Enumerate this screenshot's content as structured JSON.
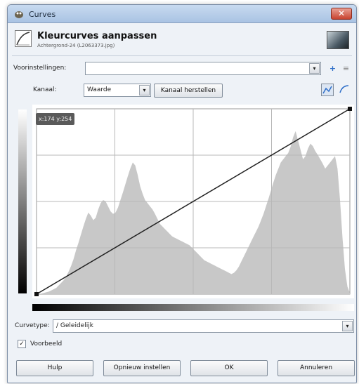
{
  "window": {
    "title": "Curves",
    "close_label": "✕"
  },
  "header": {
    "title": "Kleurcurves aanpassen",
    "subtitle": "Achtergrond-24 (L2063373.jpg)"
  },
  "presets": {
    "label": "Voorinstellingen:",
    "value": "",
    "arrow": "▾",
    "add_icon": "plus-icon",
    "menu_icon": "menu-icon"
  },
  "channel": {
    "label": "Kanaal:",
    "value": "Waarde",
    "arrow": "▾",
    "reset_label": "Kanaal herstellen",
    "linear_icon": "linear-histogram-icon",
    "log_icon": "log-histogram-icon"
  },
  "curve": {
    "coordinates": "x:174 y:254",
    "histogram": [
      0,
      0,
      1,
      2,
      3,
      4,
      6,
      8,
      10,
      14,
      18,
      22,
      28,
      36,
      45,
      56,
      70,
      82,
      95,
      108,
      120,
      130,
      125,
      118,
      122,
      135,
      145,
      150,
      148,
      140,
      132,
      128,
      130,
      138,
      150,
      162,
      175,
      188,
      200,
      210,
      205,
      190,
      172,
      160,
      150,
      145,
      140,
      135,
      128,
      120,
      112,
      108,
      104,
      100,
      96,
      92,
      90,
      88,
      86,
      84,
      82,
      80,
      78,
      74,
      70,
      66,
      62,
      58,
      54,
      52,
      50,
      48,
      46,
      44,
      42,
      40,
      38,
      36,
      34,
      32,
      34,
      38,
      44,
      52,
      60,
      68,
      76,
      84,
      92,
      100,
      108,
      118,
      128,
      140,
      152,
      165,
      178,
      190,
      200,
      210,
      215,
      220,
      225,
      235,
      250,
      260,
      245,
      230,
      215,
      220,
      232,
      240,
      236,
      228,
      222,
      215,
      208,
      200,
      205,
      210,
      215,
      220,
      200,
      150,
      90,
      40,
      12,
      2
    ],
    "line_from": [
      0,
      0
    ],
    "line_to": [
      255,
      255
    ]
  },
  "curve_type": {
    "label": "Curvetype:",
    "value": "∕ Geleidelijk",
    "arrow": "▾"
  },
  "preview": {
    "label": "Voorbeeld",
    "checked": true,
    "check_mark": "✓"
  },
  "buttons": {
    "help": "Hulp",
    "reset": "Opnieuw instellen",
    "ok": "OK",
    "cancel": "Annuleren"
  }
}
